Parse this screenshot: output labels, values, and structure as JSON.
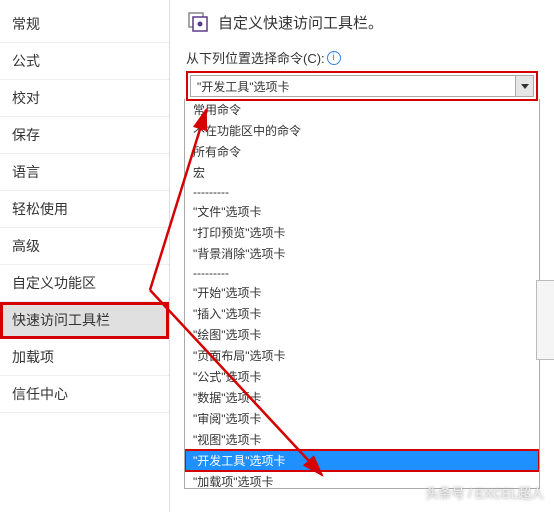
{
  "sidebar": {
    "items": [
      {
        "label": "常规"
      },
      {
        "label": "公式"
      },
      {
        "label": "校对"
      },
      {
        "label": "保存"
      },
      {
        "label": "语言"
      },
      {
        "label": "轻松使用"
      },
      {
        "label": "高级"
      },
      {
        "label": "自定义功能区"
      },
      {
        "label": "快速访问工具栏"
      },
      {
        "label": "加载项"
      },
      {
        "label": "信任中心"
      }
    ],
    "selected_index": 8
  },
  "main": {
    "title": "自定义快速访问工具栏。",
    "choose_label": "从下列位置选择命令(C):",
    "dropdown_value": "\"开发工具\"选项卡",
    "options": [
      "常用命令",
      "不在功能区中的命令",
      "所有命令",
      "宏",
      "---------",
      "\"文件\"选项卡",
      "\"打印预览\"选项卡",
      "\"背景消除\"选项卡",
      "---------",
      "\"开始\"选项卡",
      "\"插入\"选项卡",
      "\"绘图\"选项卡",
      "\"页面布局\"选项卡",
      "\"公式\"选项卡",
      "\"数据\"选项卡",
      "\"审阅\"选项卡",
      "\"视图\"选项卡",
      "\"开发工具\"选项卡",
      "\"加载项\"选项卡"
    ],
    "highlight_index": 17
  },
  "watermark": "头条号 / EXCEL超人"
}
